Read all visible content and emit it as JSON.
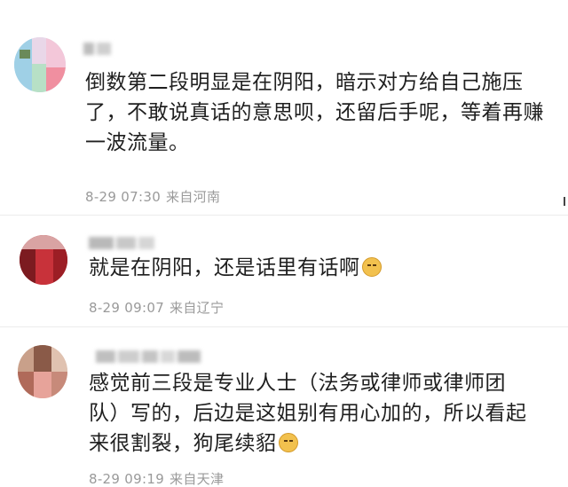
{
  "comments": [
    {
      "text_lines": [
        "倒数第二段明显是在阴阳，暗示对方给自己施压",
        "了，不敢说真话的意思呗，还留后手呢，等着再赚",
        "一波流量。"
      ],
      "time": "8-29 07:30",
      "location": "来自河南",
      "has_emoji": false
    },
    {
      "text_lines": [
        "就是在阴阳，还是话里有话啊"
      ],
      "time": "8-29 09:07",
      "location": "来自辽宁",
      "has_emoji": true,
      "emoji_icon": "doge-emoji-icon"
    },
    {
      "text_lines": [
        "感觉前三段是专业人士（法务或律师或律师团",
        "队）写的，后边是这姐别有用心加的，所以看起",
        "来很割裂，狗尾续貂"
      ],
      "time": "8-29 09:19",
      "location": "来自天津",
      "has_emoji": true,
      "emoji_icon": "doge-emoji-icon"
    }
  ],
  "colors": {
    "text": "#1f1f1f",
    "meta": "#9a9a9a",
    "divider": "#ececec",
    "emoji": "#f2c14e"
  }
}
